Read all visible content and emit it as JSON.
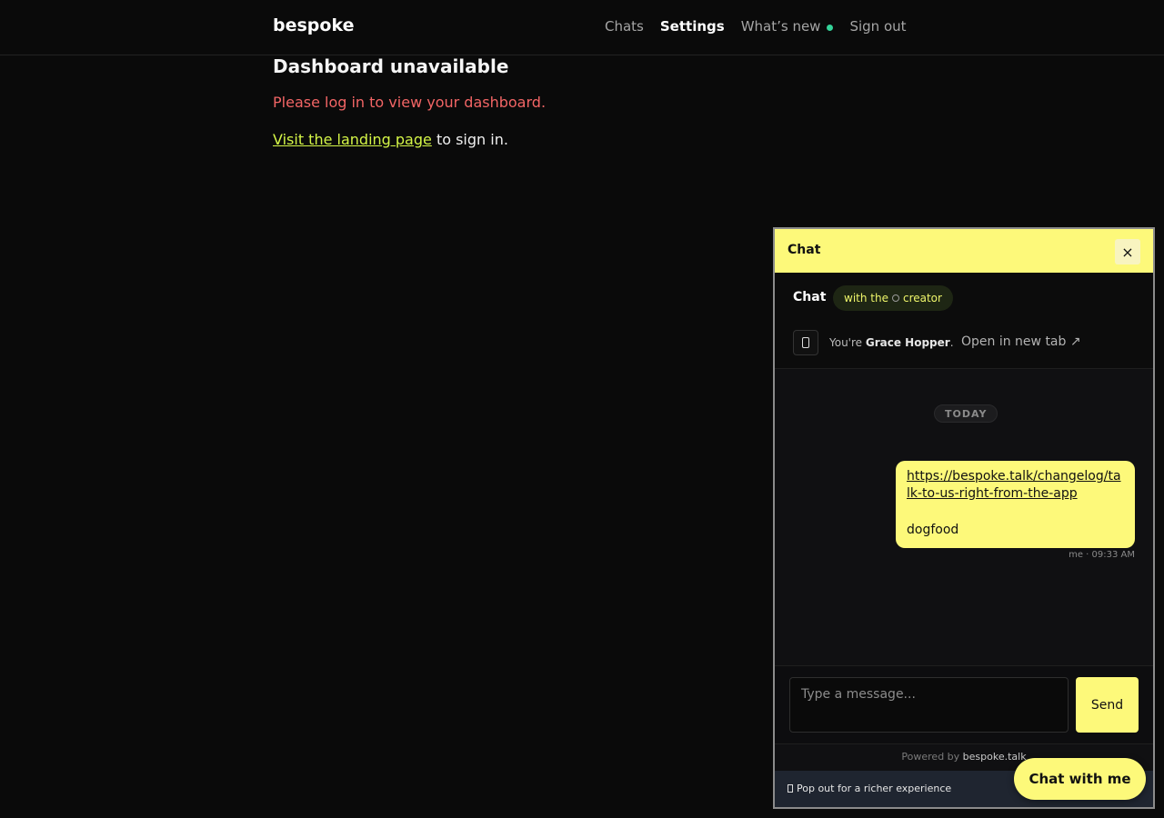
{
  "brand": {
    "name": "bespoke"
  },
  "nav": {
    "chats": "Chats",
    "settings": "Settings",
    "whats_new": "What’s new",
    "sign_out": "Sign out"
  },
  "main": {
    "title": "Dashboard unavailable",
    "error": "Please log in to view your dashboard.",
    "landing_link": "Visit the landing page",
    "hint_suffix": " to sign in."
  },
  "chat": {
    "header_title": "Chat",
    "close_glyph": "×",
    "sub_title": "Chat",
    "pill_prefix": "with the",
    "pill_suffix": "creator",
    "identity_prefix": "You're ",
    "identity_name": "Grace Hopper",
    "identity_suffix": ".",
    "open_tab": "Open in new tab ↗",
    "today": "TODAY",
    "message": {
      "link": "https://bespoke.talk/changelog/talk-to-us-right-from-the-app",
      "text": "dogfood",
      "meta": "me · 09:33 AM"
    },
    "input_placeholder": "Type a message...",
    "send": "Send",
    "powered_prefix": "Powered by ",
    "powered_brand": "bespoke.talk",
    "popout": "Pop out for a richer experience"
  },
  "fab": {
    "label": "Chat with me"
  },
  "colors": {
    "accent": "#fdf97a",
    "error": "#f26565",
    "link": "#d4f547",
    "online_dot": "#34d399"
  },
  "icons": {
    "close": "close-icon",
    "phone": "phone-icon",
    "popout": "popout-icon",
    "status_dot": "online-dot-icon",
    "ring": "ring-icon"
  }
}
